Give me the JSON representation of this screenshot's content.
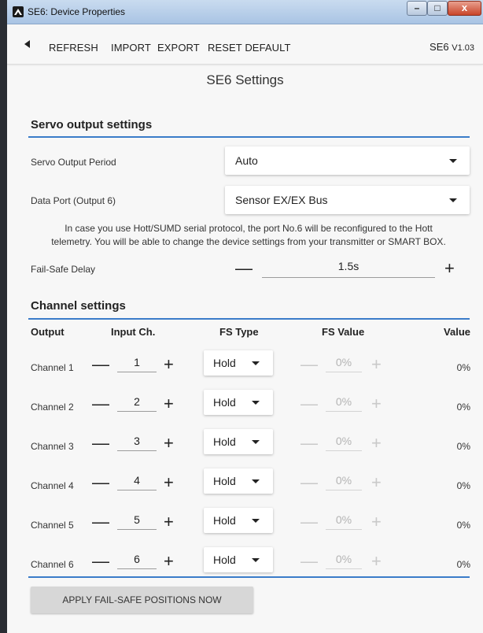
{
  "window": {
    "title": "SE6: Device Properties"
  },
  "toolbar": {
    "refresh_label": "REFRESH",
    "import_label": "IMPORT",
    "export_label": "EXPORT",
    "reset_label": "RESET DEFAULT",
    "device": "SE6",
    "version": "V1.03"
  },
  "page": {
    "title": "SE6 Settings"
  },
  "servo": {
    "section_title": "Servo output settings",
    "period_label": "Servo Output Period",
    "period_value": "Auto",
    "data_port_label": "Data Port (Output 6)",
    "data_port_value": "Sensor EX/EX Bus",
    "info_line1": "In case you use Hott/SUMD serial protocol, the port No.6 will be reconfigured to the Hott",
    "info_line2": "telemetry. You will be able to change the device settings from your transmitter or SMART BOX.",
    "failsafe_delay_label": "Fail-Safe Delay",
    "failsafe_delay_value": "1.5s"
  },
  "channels": {
    "section_title": "Channel settings",
    "headers": {
      "output": "Output",
      "input": "Input Ch.",
      "fs_type": "FS Type",
      "fs_value": "FS Value",
      "value": "Value"
    },
    "rows": [
      {
        "name": "Channel 1",
        "input": "1",
        "fs_type": "Hold",
        "fs_value": "0%",
        "value": "0%"
      },
      {
        "name": "Channel 2",
        "input": "2",
        "fs_type": "Hold",
        "fs_value": "0%",
        "value": "0%"
      },
      {
        "name": "Channel 3",
        "input": "3",
        "fs_type": "Hold",
        "fs_value": "0%",
        "value": "0%"
      },
      {
        "name": "Channel 4",
        "input": "4",
        "fs_type": "Hold",
        "fs_value": "0%",
        "value": "0%"
      },
      {
        "name": "Channel 5",
        "input": "5",
        "fs_type": "Hold",
        "fs_value": "0%",
        "value": "0%"
      },
      {
        "name": "Channel 6",
        "input": "6",
        "fs_type": "Hold",
        "fs_value": "0%",
        "value": "0%"
      }
    ]
  },
  "apply_button": "APPLY FAIL-SAFE POSITIONS NOW",
  "glyphs": {
    "minus": "—",
    "plus": "+",
    "win_min": "–",
    "win_max": "□",
    "win_close": "x"
  },
  "icons": [
    "app-logo-icon",
    "back-arrow-icon",
    "chevron-down-icon",
    "minus-icon",
    "plus-icon"
  ],
  "colors": {
    "accent": "#3a7cc9",
    "background": "#f7f7f7",
    "disabled": "#c9c9c9"
  }
}
